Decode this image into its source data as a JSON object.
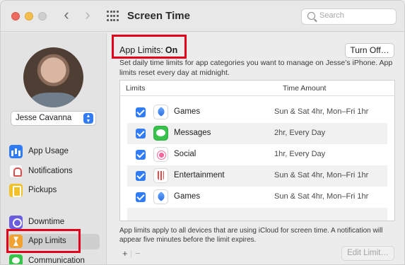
{
  "window": {
    "title": "Screen Time"
  },
  "search": {
    "placeholder": "Search"
  },
  "sidebar": {
    "user": "Jesse Cavanna",
    "items": [
      {
        "label": "App Usage",
        "icon": "app-usage-icon"
      },
      {
        "label": "Notifications",
        "icon": "notifications-icon"
      },
      {
        "label": "Pickups",
        "icon": "pickups-icon"
      },
      {
        "label": "Downtime",
        "icon": "downtime-icon"
      },
      {
        "label": "App Limits",
        "icon": "app-limits-icon",
        "selected": true
      },
      {
        "label": "Communication",
        "icon": "communication-icon"
      }
    ]
  },
  "main": {
    "heading_label": "App Limits:",
    "heading_state": "On",
    "turn_off_label": "Turn Off…",
    "description": "Set daily time limits for app categories you want to manage on Jesse’s iPhone. App limits reset every day at midnight.",
    "table": {
      "columns": [
        "Limits",
        "Time Amount"
      ],
      "rows": [
        {
          "checked": true,
          "icon": "games-icon",
          "name": "Games",
          "time": "Sun & Sat 4hr, Mon–Fri 1hr"
        },
        {
          "checked": true,
          "icon": "messages-icon",
          "name": "Messages",
          "time": "2hr, Every Day"
        },
        {
          "checked": true,
          "icon": "social-icon",
          "name": "Social",
          "time": "1hr, Every Day"
        },
        {
          "checked": true,
          "icon": "entertainment-icon",
          "name": "Entertainment",
          "time": "Sun & Sat 4hr, Mon–Fri 1hr"
        },
        {
          "checked": true,
          "icon": "games-icon",
          "name": "Games",
          "time": "Sun & Sat 4hr, Mon–Fri 1hr"
        }
      ]
    },
    "footnote": "App limits apply to all devices that are using iCloud for screen time. A notification will appear five minutes before the limit expires.",
    "add_label": "+",
    "remove_label": "−",
    "edit_limit_label": "Edit Limit…"
  },
  "colors": {
    "accent": "#2f7cf6",
    "highlight": "#e3001b"
  }
}
